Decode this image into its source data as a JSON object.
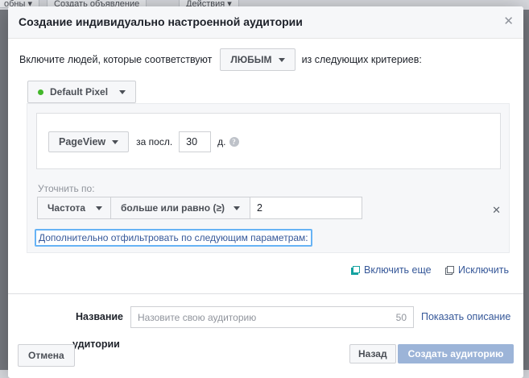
{
  "background": {
    "tabs": [
      "обны ▾",
      "Создать объявление",
      "Действия ▾"
    ]
  },
  "modal": {
    "title": "Создание индивидуально настроенной аудитории",
    "close_icon": "close-icon"
  },
  "include_row": {
    "prefix": "Включите людей, которые соответствуют",
    "match_value": "ЛЮБЫМ",
    "suffix": "из следующих критериев:"
  },
  "pixel": {
    "label": "Default Pixel",
    "status_color": "#42b72a"
  },
  "event": {
    "name": "PageView",
    "within_label": "за посл.",
    "days_value": "30",
    "days_unit": "д.",
    "info_icon": "info-icon"
  },
  "refine": {
    "label": "Уточнить по:",
    "parameter": "Частота",
    "operator": "больше или равно (≥)",
    "value": "2"
  },
  "filter_link": "Дополнительно отфильтровать по следующим параметрам:",
  "actions": {
    "include_more": "Включить еще",
    "exclude": "Исключить"
  },
  "name_field": {
    "label": "Название",
    "placeholder": "Назовите свою аудиторию",
    "char_limit": "50",
    "show_description": "Показать описание"
  },
  "partial_label": "удитории",
  "footer": {
    "cancel": "Отмена",
    "back": "Назад",
    "create": "Создать аудиторию"
  },
  "colors": {
    "link": "#365899",
    "accent_teal": "#14a2a0",
    "create_disabled": "#9cb4d8",
    "focus_border": "#67b3f5"
  }
}
